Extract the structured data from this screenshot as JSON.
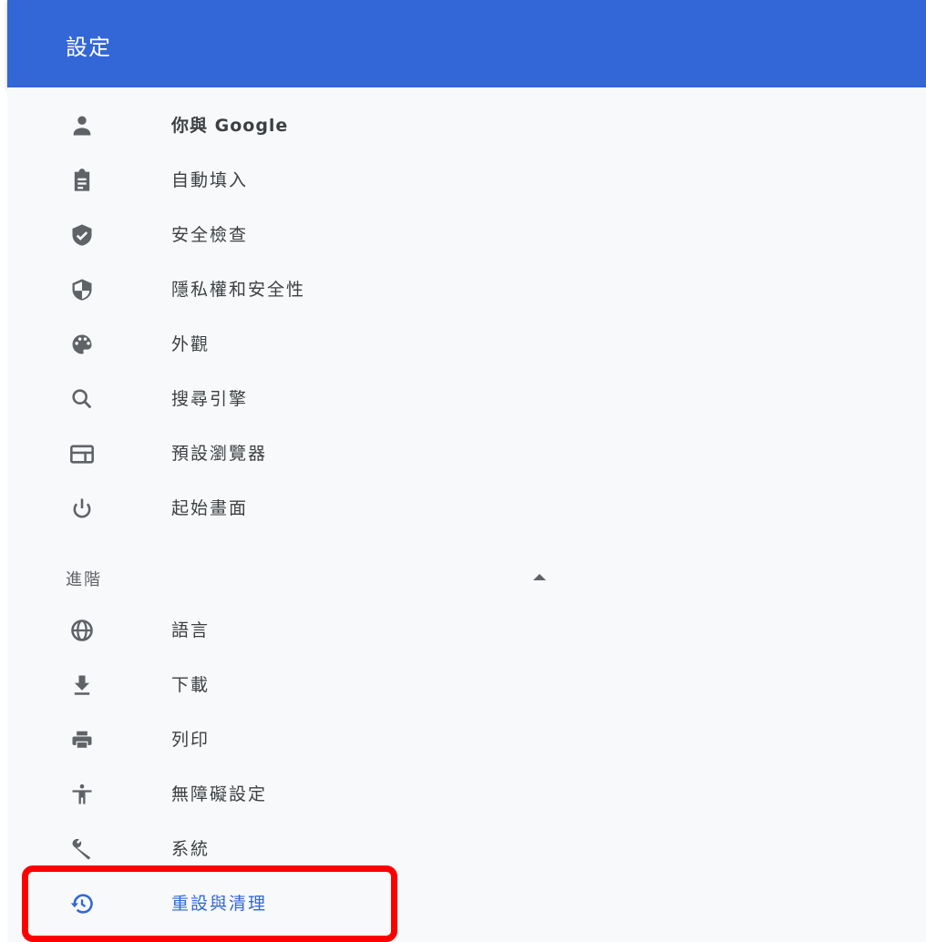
{
  "header": {
    "title": "設定"
  },
  "menu": {
    "items": [
      {
        "label": "你與 Google",
        "icon": "person-icon"
      },
      {
        "label": "自動填入",
        "icon": "clipboard-icon"
      },
      {
        "label": "安全檢查",
        "icon": "shield-check-icon"
      },
      {
        "label": "隱私權和安全性",
        "icon": "shield-half-icon"
      },
      {
        "label": "外觀",
        "icon": "palette-icon"
      },
      {
        "label": "搜尋引擎",
        "icon": "search-icon"
      },
      {
        "label": "預設瀏覽器",
        "icon": "browser-icon"
      },
      {
        "label": "起始畫面",
        "icon": "power-icon"
      }
    ],
    "advanced": {
      "label": "進階",
      "icon": "chevron-up-icon",
      "expanded": true
    },
    "advanced_items": [
      {
        "label": "語言",
        "icon": "globe-icon"
      },
      {
        "label": "下載",
        "icon": "download-icon"
      },
      {
        "label": "列印",
        "icon": "printer-icon"
      },
      {
        "label": "無障礙設定",
        "icon": "accessibility-icon"
      },
      {
        "label": "系統",
        "icon": "wrench-icon"
      },
      {
        "label": "重設與清理",
        "icon": "restore-icon",
        "active": true
      }
    ]
  },
  "colors": {
    "header_bg": "#3366d6",
    "panel_bg": "#f8f9fa",
    "active": "#3367d6",
    "icon": "#5f6368",
    "highlight": "#ff0000"
  }
}
